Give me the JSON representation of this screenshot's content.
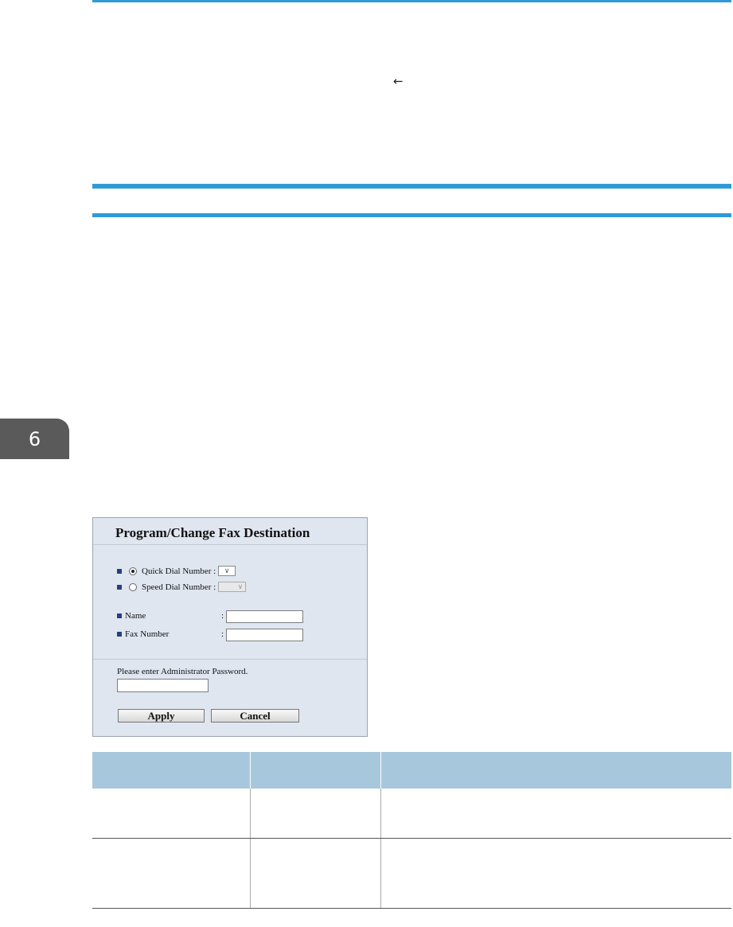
{
  "page": {
    "chapter_number": "6",
    "arrow_glyph": "←",
    "accent_color": "#2e9bd6"
  },
  "dialog": {
    "title": "Program/Change Fax Destination",
    "quick_dial_label": "Quick Dial Number :",
    "speed_dial_label": "Speed Dial Number :",
    "selected_option": "Quick Dial Number",
    "name_label": "Name",
    "fax_number_label": "Fax Number",
    "colon": ":",
    "name_value": "",
    "fax_number_value": "",
    "password_prompt": "Please enter Administrator Password.",
    "password_value": "",
    "apply_label": "Apply",
    "cancel_label": "Cancel"
  },
  "table": {
    "headers": [
      "",
      "",
      ""
    ],
    "rows": [
      [
        "",
        "",
        ""
      ],
      [
        "",
        "",
        ""
      ]
    ]
  }
}
